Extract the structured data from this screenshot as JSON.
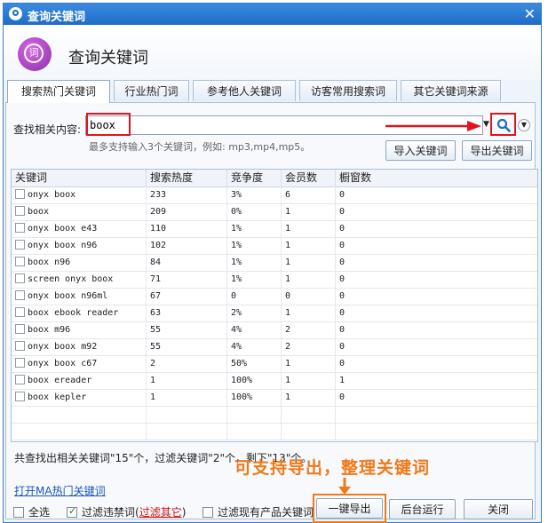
{
  "window": {
    "title": "查询关键词",
    "close_icon": "close-icon"
  },
  "header": {
    "title": "查询关键词",
    "logo_text": "词"
  },
  "tabs": [
    {
      "label": "搜索热门关键词",
      "active": true
    },
    {
      "label": "行业热门词",
      "active": false
    },
    {
      "label": "参考他人关键词",
      "active": false
    },
    {
      "label": "访客常用搜索词",
      "active": false
    },
    {
      "label": "其它关键词来源",
      "active": false
    }
  ],
  "search": {
    "label": "查找相关内容:",
    "value": "boox",
    "hint": "最多支持输入3个关键词，例如: mp3,mp4,mp5。"
  },
  "buttons": {
    "import": "导入关键词",
    "export": "导出关键词",
    "one_click_export": "一键导出",
    "background_run": "后台运行",
    "close": "关闭"
  },
  "table": {
    "columns": [
      "关键词",
      "搜索热度",
      "竞争度",
      "会员数",
      "橱窗数"
    ],
    "rows": [
      [
        "onyx boox",
        "233",
        "3%",
        "6",
        "0"
      ],
      [
        "boox",
        "209",
        "0%",
        "1",
        "0"
      ],
      [
        "onyx boox e43",
        "110",
        "1%",
        "1",
        "0"
      ],
      [
        "onyx boox n96",
        "102",
        "1%",
        "1",
        "0"
      ],
      [
        "boox n96",
        "84",
        "1%",
        "1",
        "0"
      ],
      [
        "screen onyx boox",
        "71",
        "1%",
        "1",
        "0"
      ],
      [
        "onyx boox n96ml",
        "67",
        "0",
        "0",
        "0"
      ],
      [
        "boox ebook reader",
        "63",
        "2%",
        "1",
        "0"
      ],
      [
        "boox m96",
        "55",
        "4%",
        "2",
        "0"
      ],
      [
        "onyx boox m92",
        "55",
        "4%",
        "2",
        "0"
      ],
      [
        "onyx boox c67",
        "2",
        "50%",
        "1",
        "0"
      ],
      [
        "boox ereader",
        "1",
        "100%",
        "1",
        "1"
      ],
      [
        "boox kepler",
        "1",
        "100%",
        "1",
        "0"
      ]
    ]
  },
  "summary": "共查找出相关关键词\"15\"个，过滤关键词\"2\"个，剩下\"13\"个。",
  "annotation": "可支持导出，整理关键词",
  "link": "打开MA热门关键词",
  "options": {
    "select_all": "全选",
    "filter_banned": "过滤违禁词(",
    "filter_others": "过滤其它",
    "filter_banned_close": ")",
    "filter_existing": "过滤现有产品关键词"
  },
  "colors": {
    "accent": "#1f6cc6",
    "highlight": "#e0141e",
    "annotation": "#f07a1a"
  }
}
